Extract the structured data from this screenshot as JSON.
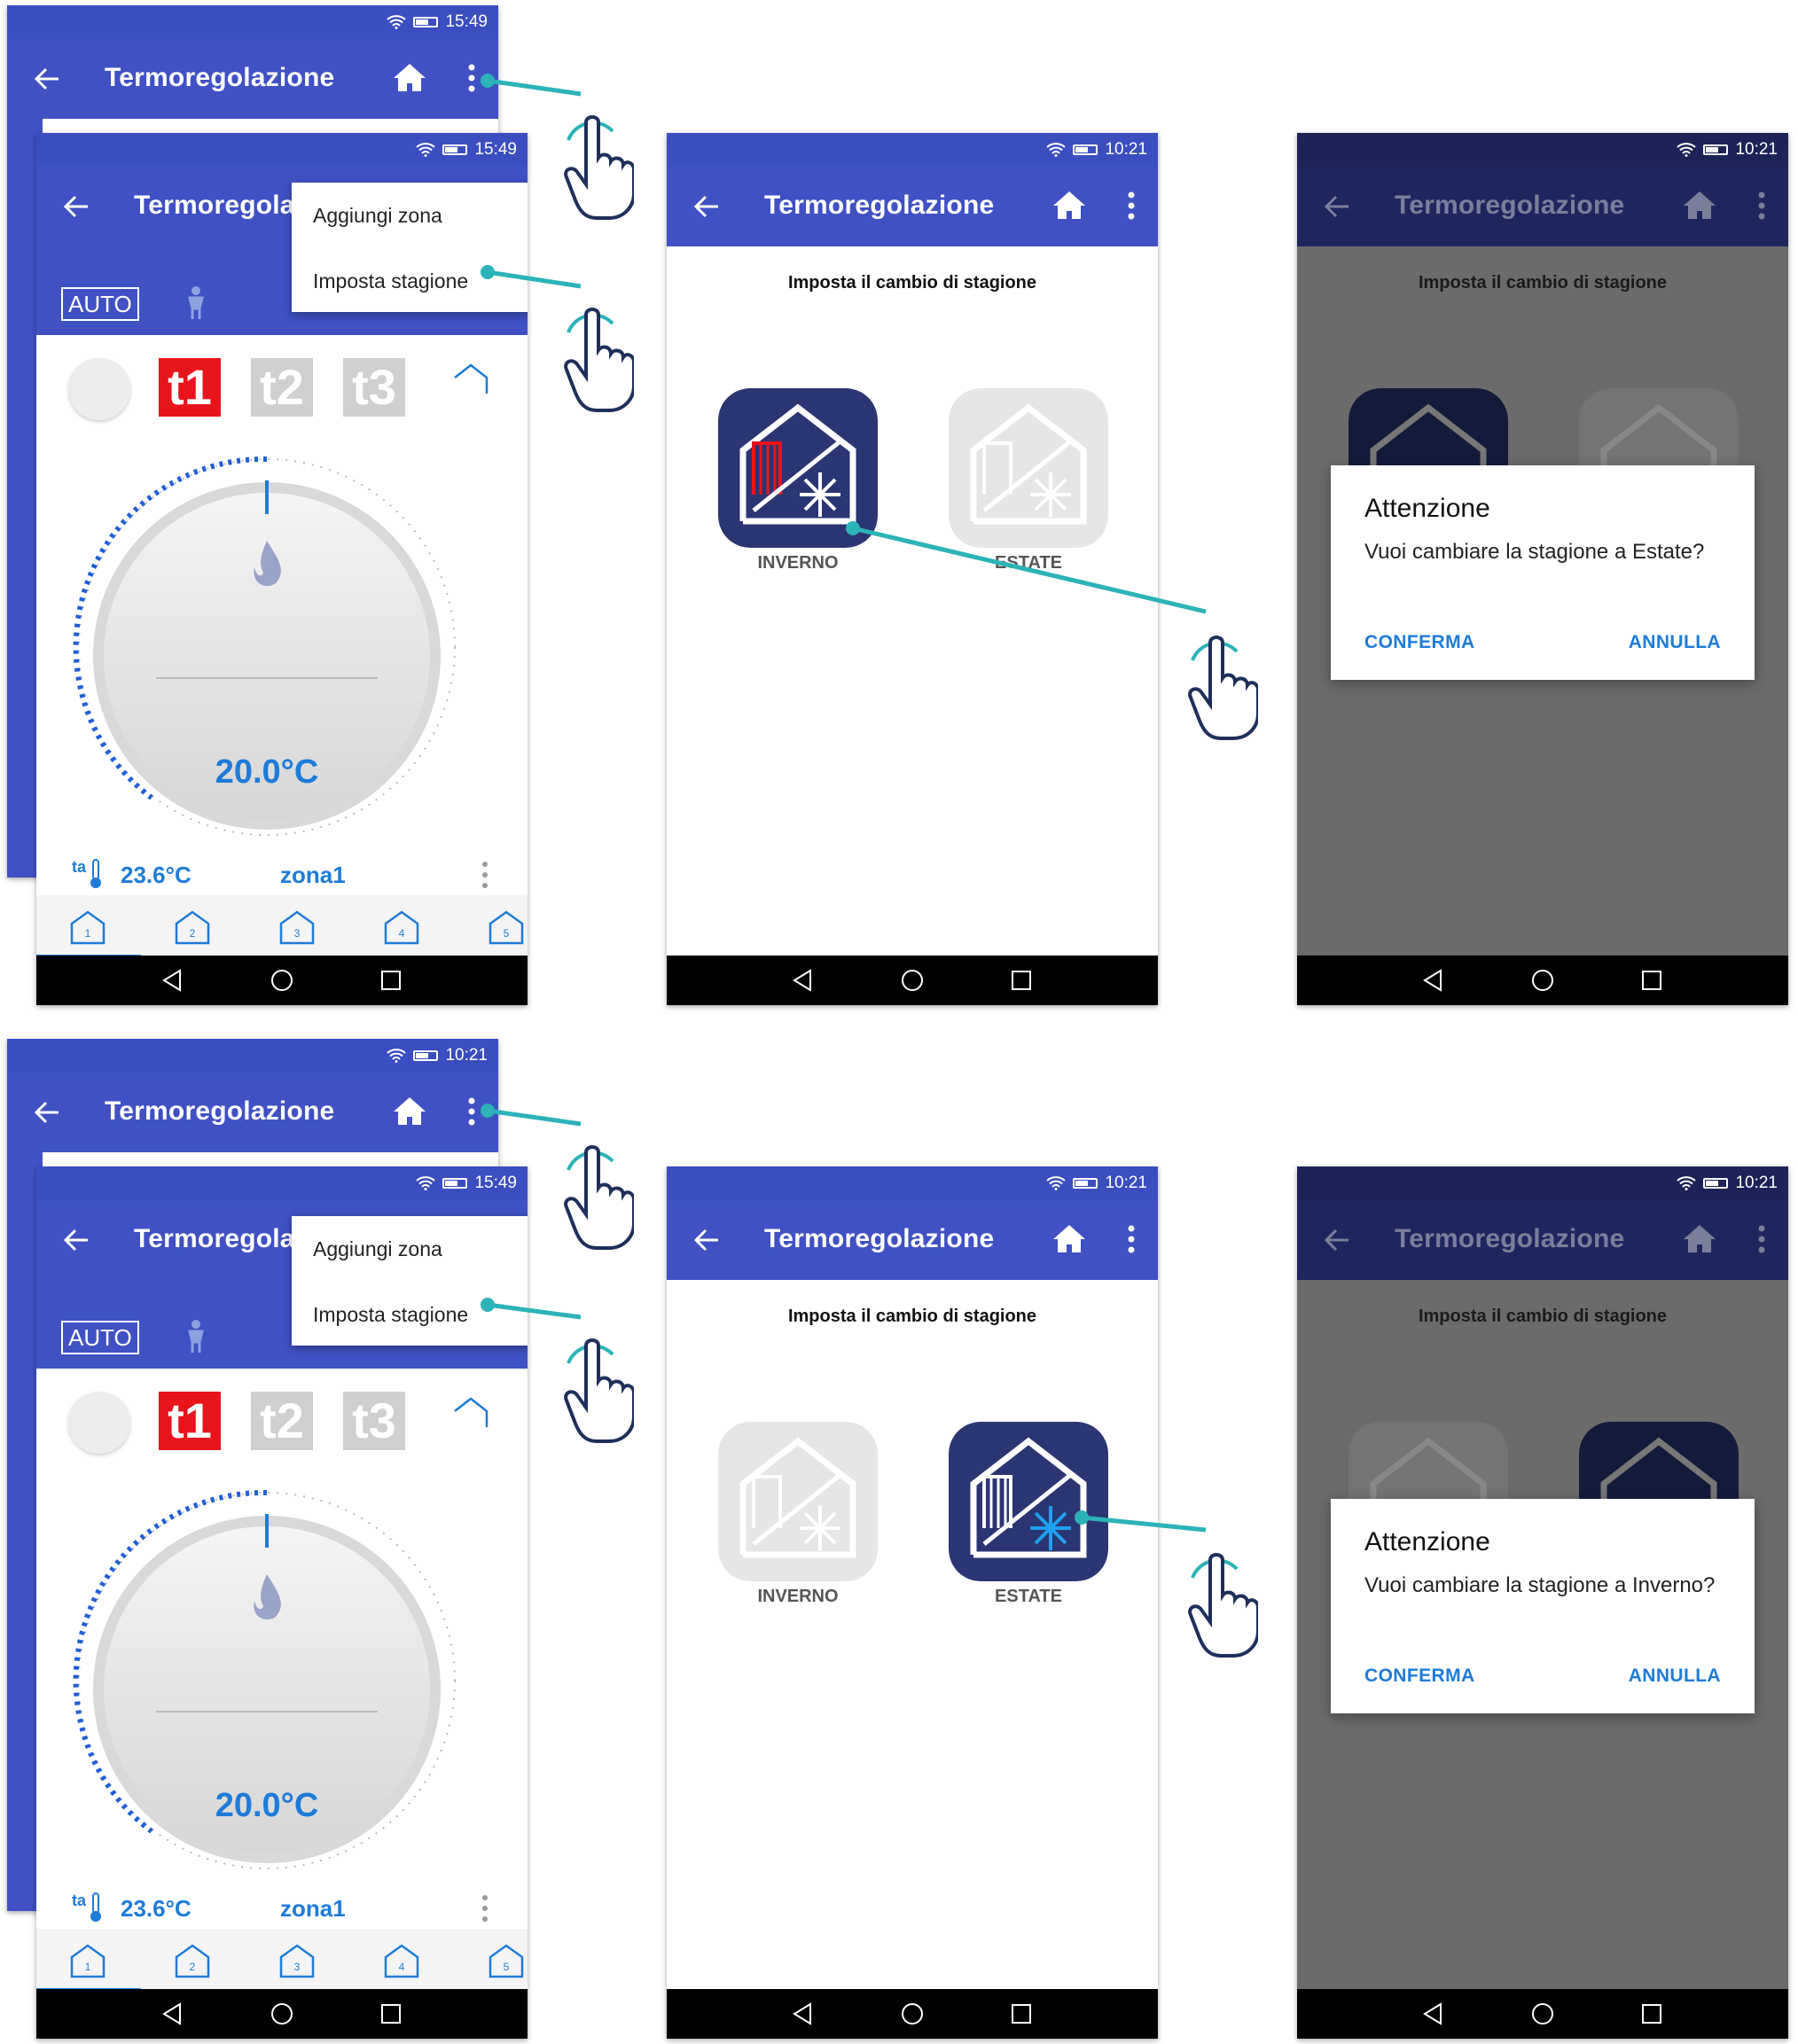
{
  "status_times": {
    "a": "15:49",
    "b": "10:21"
  },
  "app_title": "Termoregolazione",
  "menu": {
    "add_zone": "Aggiungi zona",
    "set_season": "Imposta stagione"
  },
  "thermostat": {
    "mode": "AUTO",
    "tabs": [
      "t1",
      "t2",
      "t3"
    ],
    "setpoint": "20.0°C",
    "ambient_label": "ta",
    "ambient_temp": "23.6°C",
    "zone_name": "zona1",
    "zones": [
      "1",
      "2",
      "3",
      "4",
      "5"
    ]
  },
  "season_screen": {
    "heading": "Imposta il cambio di stagione",
    "winter_label": "INVERNO",
    "summer_label": "ESTATE"
  },
  "dialog_summer": {
    "title": "Attenzione",
    "message": "Vuoi cambiare la stagione a Estate?",
    "confirm": "CONFERMA",
    "cancel": "ANNULLA"
  },
  "dialog_winter": {
    "title": "Attenzione",
    "message": "Vuoi cambiare la stagione a Inverno?",
    "confirm": "CONFERMA",
    "cancel": "ANNULLA"
  },
  "colors": {
    "appbar": "#3f51c3",
    "accent": "#1e7bd8",
    "active_season": "#2b3573",
    "inactive_season": "#e6e6e6",
    "t1_active": "#e8141b",
    "pointer_line": "#2bb3b8"
  }
}
